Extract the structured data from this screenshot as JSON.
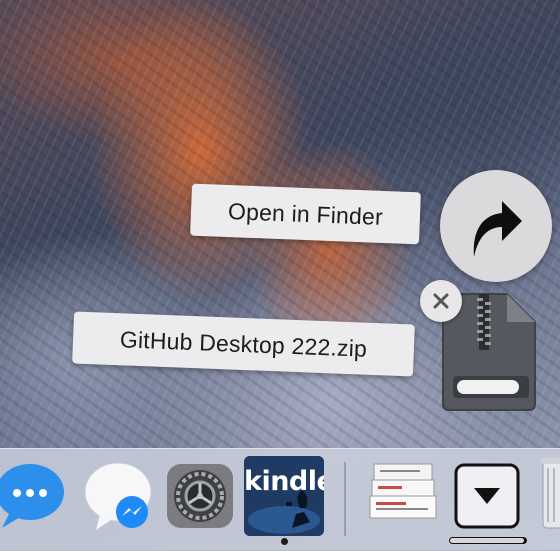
{
  "tooltips": {
    "open_in_finder": "Open in Finder",
    "file_name": "GitHub Desktop 222.zip"
  },
  "icons": {
    "action": "curved-arrow-icon",
    "close": "close-icon",
    "file": "zip-archive-icon"
  },
  "dock": {
    "items": [
      {
        "name": "Messages",
        "icon": "messages-icon"
      },
      {
        "name": "Messenger",
        "icon": "messenger-icon"
      },
      {
        "name": "System Preferences",
        "icon": "system-preferences-icon"
      },
      {
        "name": "Kindle",
        "icon": "kindle-icon",
        "label": "kindle",
        "running": true
      },
      {
        "name": "Downloads stack",
        "icon": "downloads-stack-icon"
      },
      {
        "name": "Download in progress",
        "icon": "download-arrow-icon",
        "progress": 0.97
      },
      {
        "name": "Trash",
        "icon": "trash-icon"
      }
    ]
  },
  "colors": {
    "tooltip_bg": "#ecebee",
    "messenger_blue": "#1e8af5",
    "messages_blue": "#2d8fec",
    "kindle_bg": "#1f3a63"
  }
}
